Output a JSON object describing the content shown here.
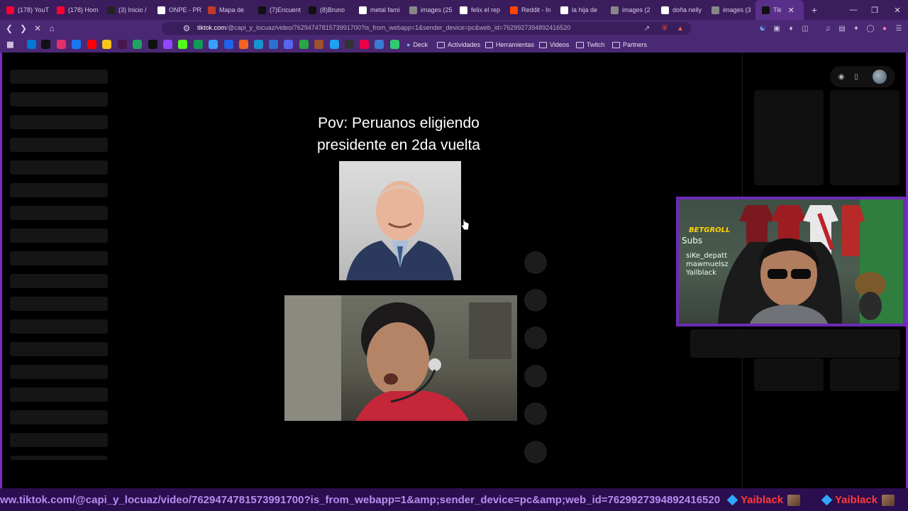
{
  "browser": {
    "tabs": [
      {
        "label": "(178) YouT",
        "icon": "youtube-icon",
        "color": "#ff0033"
      },
      {
        "label": "(178) Hom",
        "icon": "youtube-icon",
        "color": "#ff0033"
      },
      {
        "label": "(3) Inicio /",
        "icon": "x-icon",
        "color": "#222222"
      },
      {
        "label": "ONPE - PR",
        "icon": "onpe-icon",
        "color": "#ffffff"
      },
      {
        "label": "Mapa de",
        "icon": "map-icon",
        "color": "#c0392b"
      },
      {
        "label": "(7)Encuent",
        "icon": "tiktok-icon",
        "color": "#111111"
      },
      {
        "label": "(8)Bruno",
        "icon": "tiktok-icon",
        "color": "#111111"
      },
      {
        "label": "metal fami",
        "icon": "google-icon",
        "color": "#ffffff"
      },
      {
        "label": "images (25",
        "icon": "globe-icon",
        "color": "#888888"
      },
      {
        "label": "felix el rep",
        "icon": "google-icon",
        "color": "#ffffff"
      },
      {
        "label": "Reddit - In",
        "icon": "reddit-icon",
        "color": "#ff4500"
      },
      {
        "label": "la hija de",
        "icon": "google-icon",
        "color": "#ffffff"
      },
      {
        "label": "images (2",
        "icon": "globe-icon",
        "color": "#888888"
      },
      {
        "label": "doña nelly",
        "icon": "google-icon",
        "color": "#ffffff"
      },
      {
        "label": "images (3",
        "icon": "globe-icon",
        "color": "#888888"
      },
      {
        "label": "Tik",
        "icon": "tiktok-icon",
        "color": "#111111",
        "active": true
      }
    ],
    "new_tab": "+",
    "url_host": "tiktok.com",
    "url_rest": "/@capi_y_locuaz/video/7629474781573991700?is_from_webapp=1&sender_device=pc&web_id=7629927394892416520",
    "bookmarks": [
      "Deck",
      "Actividades",
      "Herramientas",
      "Videos",
      "Twitch",
      "Partners"
    ],
    "status_url": "ww.tiktok.com/@capi_y_locuaz/video/7629474781573991700?is_from_webapp=1&amp;sender_device=pc&amp;web_id=7629927394892416520"
  },
  "video": {
    "caption": "Pov: Peruanos eligiendo presidente en 2da vuelta"
  },
  "webcam": {
    "overlay_lines": [
      "BETGROLL",
      "Subs",
      "siKe_depatt",
      "mawmuelsz",
      "Yailblack"
    ]
  },
  "ticker": {
    "name_1": "Yaiblack",
    "name_2": "Yaiblack"
  },
  "colors": {
    "chrome_purple": "#4a2873",
    "tab_strip": "#3b1d5e",
    "accent_purple": "#7a2bbf",
    "ticker_red": "#ff3b3b"
  }
}
